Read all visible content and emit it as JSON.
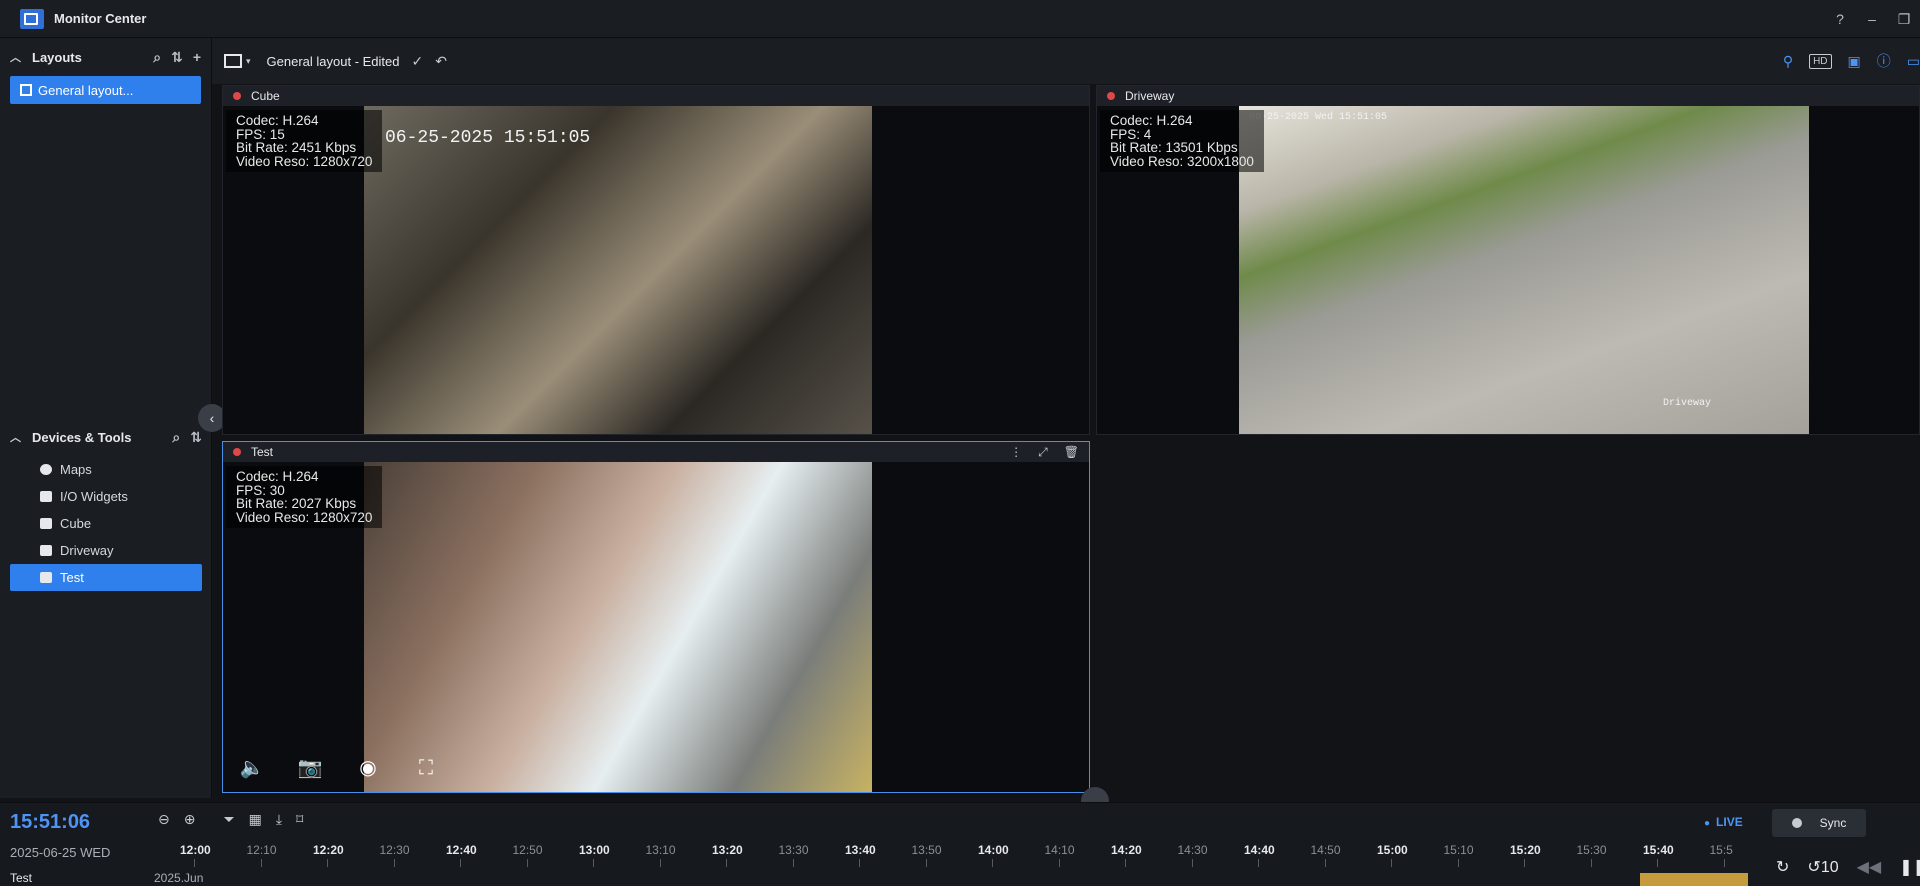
{
  "app": {
    "title": "Monitor Center"
  },
  "window_controls": [
    "?",
    "–",
    "❐"
  ],
  "layouts": {
    "header": "Layouts",
    "items": [
      {
        "label": "General layout..."
      }
    ]
  },
  "devices": {
    "header": "Devices & Tools",
    "items": [
      {
        "label": "Maps",
        "icon": "globe-icon"
      },
      {
        "label": "I/O Widgets",
        "icon": "widget-icon"
      },
      {
        "label": "Cube",
        "icon": "camera-icon"
      },
      {
        "label": "Driveway",
        "icon": "camera-icon"
      },
      {
        "label": "Test",
        "icon": "camera-icon"
      }
    ]
  },
  "toolbar": {
    "layout_label": "General layout - Edited",
    "hd": "HD"
  },
  "cameras": {
    "cube": {
      "name": "Cube",
      "codec": "Codec: H.264",
      "fps": "FPS: 15",
      "bitrate": "Bit Rate: 2451 Kbps",
      "reso": "Video Reso: 1280x720",
      "osd_time": "06-25-2025 15:51:05"
    },
    "driveway": {
      "name": "Driveway",
      "codec": "Codec: H.264",
      "fps": "FPS: 4",
      "bitrate": "Bit Rate: 13501 Kbps",
      "reso": "Video Reso: 3200x1800",
      "osd_time": "06-25-2025 Wed 15:51:05",
      "osd_label": "Driveway"
    },
    "test": {
      "name": "Test",
      "codec": "Codec: H.264",
      "fps": "FPS: 30",
      "bitrate": "Bit Rate: 2027 Kbps",
      "reso": "Video Reso: 1280x720"
    }
  },
  "timeline": {
    "clock": "15:51:06",
    "date": "2025-06-25 WED",
    "live": "LIVE",
    "sync": "Sync",
    "row_name": "Test",
    "month": "2025.Jun",
    "ticks": [
      "12:00",
      "12:10",
      "12:20",
      "12:30",
      "12:40",
      "12:50",
      "13:00",
      "13:10",
      "13:20",
      "13:30",
      "13:40",
      "13:50",
      "14:00",
      "14:10",
      "14:20",
      "14:30",
      "14:40",
      "14:50",
      "15:00",
      "15:10",
      "15:20",
      "15:30",
      "15:40",
      "15:5"
    ],
    "playback": [
      "↻",
      "↺10",
      "◀◀",
      "❚❚",
      "▶▶"
    ]
  },
  "colors": {
    "accent": "#2f80ed",
    "rec": "#e04848",
    "recording_bar": "#c59b3e"
  }
}
